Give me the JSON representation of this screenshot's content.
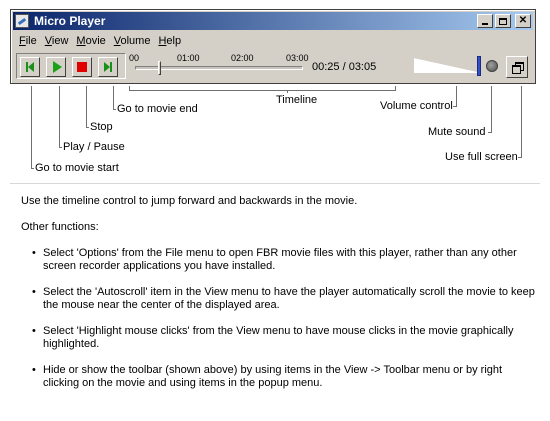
{
  "window": {
    "title": "Micro Player"
  },
  "menu": [
    {
      "label": "File",
      "accel": "F",
      "rest": "ile"
    },
    {
      "label": "View",
      "accel": "V",
      "rest": "iew"
    },
    {
      "label": "Movie",
      "accel": "M",
      "rest": "ovie"
    },
    {
      "label": "Volume",
      "accel": "V",
      "rest": "olume"
    },
    {
      "label": "Help",
      "accel": "H",
      "rest": "elp"
    }
  ],
  "timeline": {
    "ticks": [
      "00",
      "01:00",
      "02:00",
      "03:00"
    ],
    "current": "00:25",
    "total": "03:05",
    "readout": "00:25 / 03:05",
    "position_seconds": 25,
    "duration_seconds": 185
  },
  "volume": {
    "level": 1.0
  },
  "callouts": {
    "timeline": "Timeline",
    "go_to_movie_end": "Go to movie end",
    "volume_control": "Volume control",
    "stop": "Stop",
    "mute_sound": "Mute sound",
    "play_pause": "Play / Pause",
    "use_full_screen": "Use full screen",
    "go_to_movie_start": "Go to movie start"
  },
  "help": {
    "intro": "Use the timeline control to jump forward and backwards in the movie.",
    "other_heading": "Other functions:",
    "bullets": [
      "Select 'Options' from the File menu to open FBR movie files with this player, rather than any other screen recorder applications you have installed.",
      "Select the 'Autoscroll' item in the View menu to have the player automatically scroll the movie to keep the mouse near the center of the displayed area.",
      "Select 'Highlight mouse clicks' from the View menu to have mouse clicks in the movie graphically highlighted.",
      "Hide or show the toolbar (shown above) by using items in the View -> Toolbar menu or by right clicking on the movie and using items in the popup menu."
    ]
  },
  "icons": {
    "app": "app-icon",
    "minimize": "minimize-icon",
    "maximize": "maximize-icon",
    "close": "close-icon",
    "start": "skip-to-start-icon",
    "play": "play-icon",
    "stop": "stop-icon",
    "end": "skip-to-end-icon",
    "mute": "mute-icon",
    "fullscreen": "fullscreen-icon"
  },
  "colors": {
    "title_gradient_start": "#0a246a",
    "title_gradient_end": "#a6caf0",
    "play_green": "#1aa31a",
    "stop_red": "#e00000",
    "volume_thumb": "#3050c8"
  }
}
